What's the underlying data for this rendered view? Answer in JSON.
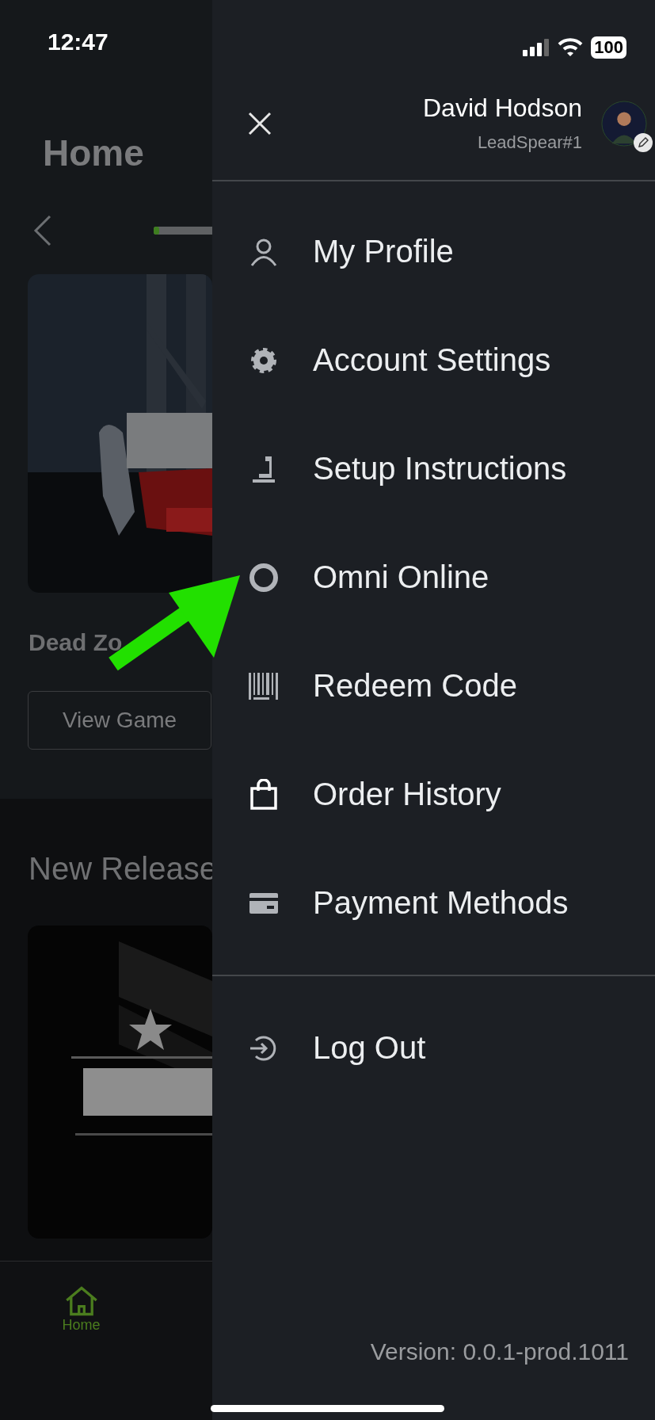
{
  "status_bar": {
    "time": "12:47",
    "battery": "100"
  },
  "background_page": {
    "title": "Home",
    "featured": {
      "kind": "picture",
      "title": "Dead Zo",
      "button": "View Game",
      "level": 0.06
    },
    "section_title": "New Release",
    "tab_bar": [
      {
        "label": "Home",
        "selected": true
      }
    ]
  },
  "drawer": {
    "user": {
      "name": "David Hodson",
      "handle": "LeadSpear#1"
    },
    "menu": [
      {
        "label": "My Profile"
      },
      {
        "label": "Account Settings"
      },
      {
        "label": "Setup Instructions"
      },
      {
        "label": "Omni Online"
      },
      {
        "label": "Redeem Code"
      },
      {
        "label": "Order History"
      },
      {
        "label": "Payment Methods"
      }
    ],
    "footer_menu": [
      {
        "label": "Log Out"
      }
    ],
    "version": "Version: 0.0.1-prod.1011"
  }
}
